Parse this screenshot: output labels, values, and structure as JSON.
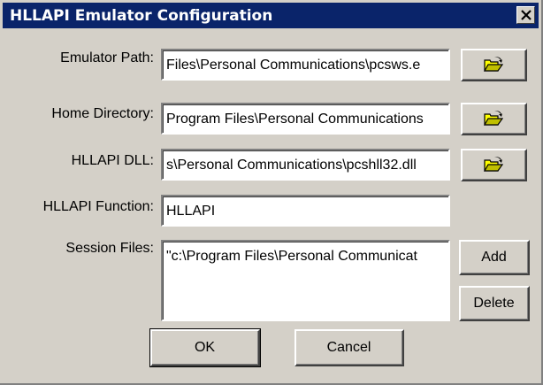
{
  "window": {
    "title": "HLLAPI Emulator Configuration",
    "close_icon": "close-icon"
  },
  "fields": {
    "emulator_path": {
      "label": "Emulator Path:",
      "value": "Files\\Personal Communications\\pcsws.e"
    },
    "home_directory": {
      "label": "Home Directory:",
      "value": "Program Files\\Personal Communications"
    },
    "hllapi_dll": {
      "label": "HLLAPI DLL:",
      "value": "s\\Personal Communications\\pcshll32.dll"
    },
    "hllapi_function": {
      "label": "HLLAPI Function:",
      "value": "HLLAPI"
    },
    "session_files": {
      "label": "Session Files:",
      "items": [
        "\"c:\\Program Files\\Personal Communicat"
      ]
    }
  },
  "buttons": {
    "browse_icon": "open-folder-icon",
    "add": "Add",
    "delete": "Delete",
    "ok": "OK",
    "cancel": "Cancel"
  },
  "colors": {
    "titlebar": "#0a246a",
    "face": "#d4d0c8"
  }
}
